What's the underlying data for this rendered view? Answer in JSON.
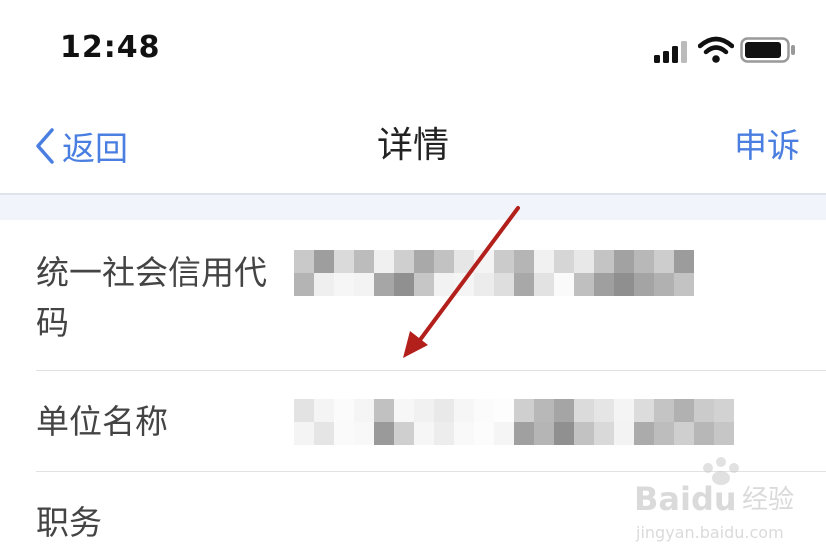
{
  "status_bar": {
    "time": "12:48",
    "icons": [
      "cellular-signal-icon",
      "wifi-icon",
      "battery-icon"
    ]
  },
  "nav": {
    "back_label": "返回",
    "title": "详情",
    "action_label": "申诉"
  },
  "fields": [
    {
      "label": "统一社会信用代码",
      "value_redacted": true
    },
    {
      "label": "单位名称",
      "value_redacted": true
    },
    {
      "label": "职务"
    }
  ],
  "watermark": {
    "brand": "Baidu",
    "brand_cn": "经验",
    "url": "jingyan.baidu.com"
  },
  "colors": {
    "accent": "#4a7ee0",
    "annotation_arrow": "#b3201c",
    "band": "#f1f4fb"
  }
}
